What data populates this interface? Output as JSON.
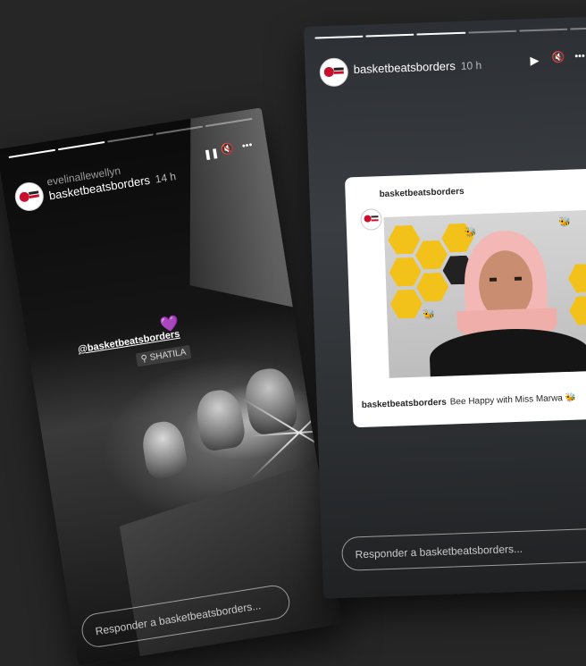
{
  "story_left": {
    "viewer": "evelinallewellyn",
    "username": "basketbeatsborders",
    "time": "14 h",
    "mention": "@basketbeatsborders",
    "location": "SHATILA",
    "reply_placeholder": "Responder a basketbeatsborders...",
    "controls": {
      "pause": "❚❚",
      "mute": "🔇",
      "more": "•••"
    }
  },
  "story_right": {
    "username": "basketbeatsborders",
    "time": "10 h",
    "controls": {
      "play": "▶",
      "mute": "🔇",
      "more": "•••"
    },
    "post": {
      "username": "basketbeatsborders",
      "caption_user": "basketbeatsborders",
      "caption_text": "Bee Happy with Miss Marwa 🐝"
    },
    "reply_placeholder": "Responder a basketbeatsborders..."
  }
}
